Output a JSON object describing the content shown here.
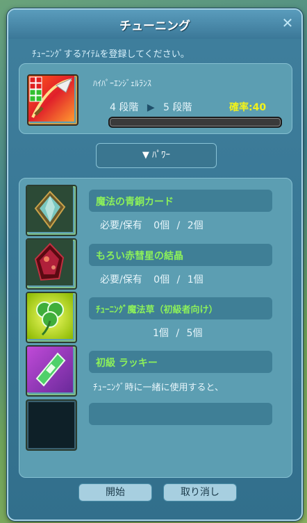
{
  "window": {
    "title": "チューニング",
    "close_label": "✕",
    "instruction": "ﾁｭｰﾆﾝｸﾞするｱｲﾃﾑを登録してください。"
  },
  "item": {
    "name": "ﾊｲﾊﾟｰｴﾝｼﾞｪﾙﾗﾝｽ",
    "from_grade": "4 段階",
    "arrow": "▶",
    "to_grade": "5 段階",
    "success_rate": "確率:40",
    "progress_fraction": 0.0
  },
  "power_button": {
    "label": "▼ ﾊﾟﾜｰ"
  },
  "materials": [
    {
      "name": "魔法の青銅カード",
      "label": "必要/保有",
      "required": "0個",
      "sep": "/",
      "owned": "2個",
      "icon": "bronze-card-icon"
    },
    {
      "name": "もろい赤彗星の結晶",
      "label": "必要/保有",
      "required": "0個",
      "sep": "/",
      "owned": "1個",
      "icon": "red-comet-crystal-icon"
    },
    {
      "name": "ﾁｭｰﾆﾝｸﾞ魔法草（初級者向け）",
      "label": "",
      "required": "1個",
      "sep": "/",
      "owned": "5個",
      "icon": "clover-icon"
    },
    {
      "name": "初級 ラッキー",
      "description": "ﾁｭｰﾆﾝｸﾞ時に一緒に使用すると、",
      "icon": "lucky-ticket-icon"
    },
    {
      "name": "",
      "icon": "empty-slot"
    }
  ],
  "footer": {
    "start_label": "開始",
    "cancel_label": "取り消し"
  },
  "colors": {
    "title_bg": "#3b7898",
    "panel": "#5c9eb2",
    "rate": "#f2f21a",
    "material_name": "#8cf05a"
  }
}
